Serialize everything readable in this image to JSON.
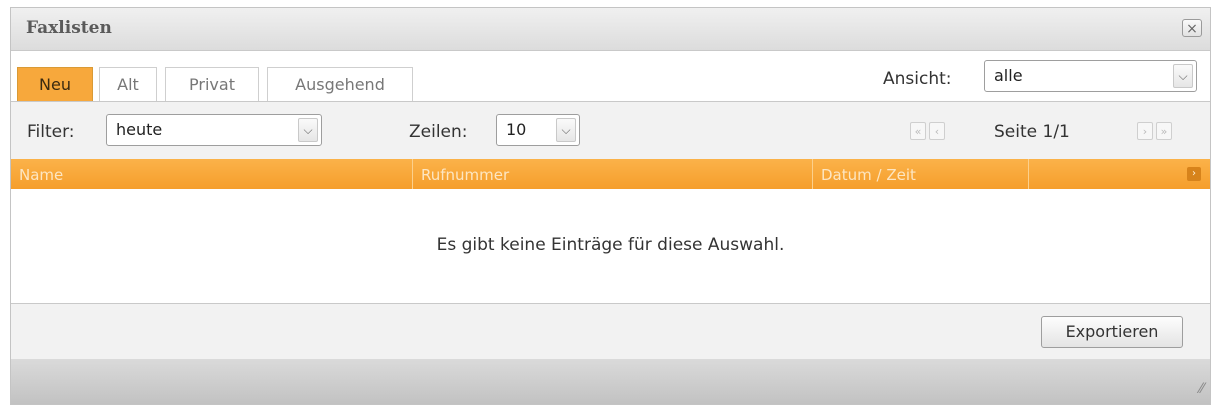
{
  "window": {
    "title": "Faxlisten",
    "close_symbol": "×"
  },
  "tabs": [
    {
      "label": "Neu",
      "active": true
    },
    {
      "label": "Alt",
      "active": false
    },
    {
      "label": "Privat",
      "active": false
    },
    {
      "label": "Ausgehend",
      "active": false
    }
  ],
  "view": {
    "label": "Ansicht:",
    "selected": "alle"
  },
  "filter": {
    "label": "Filter:",
    "selected": "heute"
  },
  "rows": {
    "label": "Zeilen:",
    "selected": "10"
  },
  "pagination": {
    "first": "«",
    "prev": "‹",
    "next": "›",
    "last": "»",
    "text": "Seite 1/1"
  },
  "table": {
    "columns": [
      "Name",
      "Rufnummer",
      "Datum / Zeit",
      ""
    ],
    "more_symbol": "›",
    "empty_message": "Es gibt keine Einträge für diese Auswahl."
  },
  "footer": {
    "export_label": "Exportieren"
  },
  "colors": {
    "accent": "#f7a83c",
    "header_text": "#fde6c2"
  }
}
